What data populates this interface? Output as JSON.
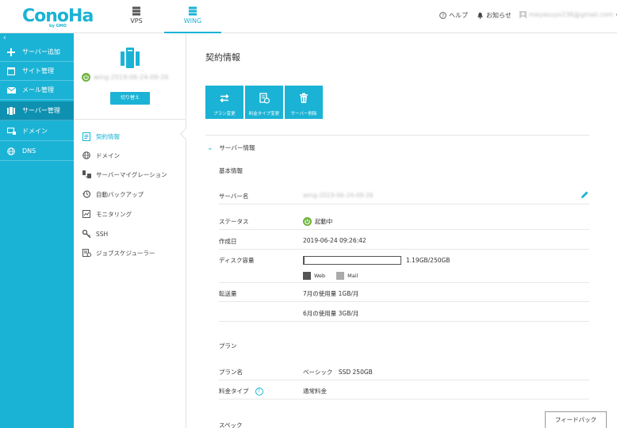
{
  "header": {
    "logo": "ConoHa",
    "logo_sub": "by GMO",
    "tabs": [
      {
        "label": "VPS",
        "icon": "server-stack-icon"
      },
      {
        "label": "WING",
        "icon": "server-stack-icon"
      }
    ],
    "help_label": "ヘルプ",
    "notice_label": "お知らせ",
    "account_email": "meyasuyo236@gmail.com"
  },
  "sidebar": {
    "collapse_symbol": "‹",
    "items": [
      {
        "label": "サーバー追加",
        "icon": "plus-icon"
      },
      {
        "label": "サイト管理",
        "icon": "window-icon"
      },
      {
        "label": "メール管理",
        "icon": "mail-icon"
      },
      {
        "label": "サーバー管理",
        "icon": "server-icon"
      },
      {
        "label": "ドメイン",
        "icon": "domain-icon"
      },
      {
        "label": "DNS",
        "icon": "globe-icon"
      }
    ]
  },
  "subpanel": {
    "server_name": "wing-2019-06-24-09-26",
    "switch_label": "切り替え",
    "items": [
      {
        "label": "契約情報",
        "icon": "contract-icon"
      },
      {
        "label": "ドメイン",
        "icon": "globe-icon"
      },
      {
        "label": "サーバーマイグレーション",
        "icon": "migration-icon"
      },
      {
        "label": "自動バックアップ",
        "icon": "backup-icon"
      },
      {
        "label": "モニタリング",
        "icon": "chart-icon"
      },
      {
        "label": "SSH",
        "icon": "key-icon"
      },
      {
        "label": "ジョブスケジューラー",
        "icon": "scheduler-icon"
      }
    ]
  },
  "main": {
    "title": "契約情報",
    "toolbar": [
      {
        "label": "プラン変更",
        "icon": "swap-icon"
      },
      {
        "label": "料金タイプ変更",
        "icon": "billing-icon"
      },
      {
        "label": "サーバー削除",
        "icon": "trash-icon"
      }
    ],
    "section_title": "サーバー情報",
    "basic_group": "基本情報",
    "server_name_label": "サーバー名",
    "server_name_value": "wing-2019-06-24-09-26",
    "status_label": "ステータス",
    "status_value": "起動中",
    "created_label": "作成日",
    "created_value": "2019-06-24 09:26:42",
    "disk_label": "ディスク容量",
    "disk_value": "1.19GB/250GB",
    "disk_used_fraction": 0.005,
    "legend_web": "Web",
    "legend_mail": "Mail",
    "transfer_label": "転送量",
    "transfer_july": "7月の使用量 1GB/月",
    "transfer_june": "6月の使用量 3GB/月",
    "plan_group": "プラン",
    "plan_name_label": "プラン名",
    "plan_name_value": "ベーシック　SSD 250GB",
    "fee_type_label": "料金タイプ",
    "fee_type_help": "?",
    "fee_type_value": "通常料金",
    "spec_group": "スペック",
    "feedback_label": "フィードバック"
  },
  "colors": {
    "accent": "#1bb3d5",
    "accent_dark": "#0e91b0",
    "status_green": "#6db33f",
    "web_swatch": "#555555",
    "mail_swatch": "#aaaaaa"
  }
}
